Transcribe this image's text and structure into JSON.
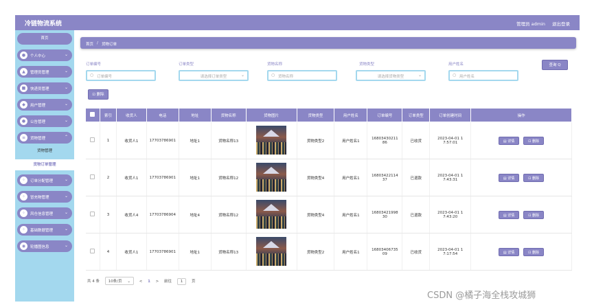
{
  "app": {
    "title": "冷链物流系统",
    "user": "管理员 admin",
    "logout": "退出登录"
  },
  "sidebar": {
    "home": "首页",
    "items": [
      {
        "label": "个人中心",
        "icon": "person-icon"
      },
      {
        "label": "管理员管理",
        "icon": "admin-icon"
      },
      {
        "label": "快递员管理",
        "icon": "courier-icon"
      },
      {
        "label": "用户管理",
        "icon": "users-icon"
      },
      {
        "label": "公告管理",
        "icon": "notice-icon"
      },
      {
        "label": "货物管理",
        "icon": "goods-icon"
      },
      {
        "label": "订单分配管理",
        "icon": "assign-icon"
      },
      {
        "label": "冒充物管理",
        "icon": "grid-icon"
      },
      {
        "label": "风仓信息管理",
        "icon": "warehouse-icon"
      },
      {
        "label": "基础数据管理",
        "icon": "data-icon"
      },
      {
        "label": "轮播图信息",
        "icon": "carousel-icon"
      }
    ],
    "sub_goods": "货物管理",
    "sub_orders": "货物订单管理"
  },
  "breadcrumb": {
    "home": "首页",
    "sep": "/",
    "current": "货物订单"
  },
  "filters": {
    "order_no": {
      "label": "订单编号",
      "placeholder": "订单编号"
    },
    "order_type": {
      "label": "订单类型",
      "placeholder": "请选择订单类型"
    },
    "goods_name": {
      "label": "货物名称",
      "placeholder": "货物名称"
    },
    "goods_type": {
      "label": "货物类型",
      "placeholder": "请选择货物类型"
    },
    "user_name": {
      "label": "用户姓名",
      "placeholder": "用户姓名"
    }
  },
  "buttons": {
    "query": "查询 Q",
    "delete": "删除",
    "detail": "详情",
    "row_delete": "删除"
  },
  "table": {
    "headers": [
      "",
      "索引",
      "收货人",
      "电话",
      "地址",
      "货物名称",
      "货物图片",
      "货物类型",
      "用户姓名",
      "订单编号",
      "订单类型",
      "订单创建时间",
      "操作"
    ],
    "rows": [
      {
        "idx": "1",
        "receiver": "收货人1",
        "phone": "17703786901",
        "addr": "地址1",
        "goods": "货物名称13",
        "gtype": "货物类型2",
        "user": "用户姓名1",
        "order_no_a": "16803430211",
        "order_no_b": "86",
        "otype": "已收货",
        "time_a": "2023-04-01 1",
        "time_b": "7:57:01"
      },
      {
        "idx": "2",
        "receiver": "收货人1",
        "phone": "17703786901",
        "addr": "地址1",
        "goods": "货物名称12",
        "gtype": "货物类型4",
        "user": "用户姓名1",
        "order_no_a": "16803422114",
        "order_no_b": "37",
        "otype": "已退款",
        "time_a": "2023-04-01 1",
        "time_b": "7:43:31"
      },
      {
        "idx": "3",
        "receiver": "收货人4",
        "phone": "17703786904",
        "addr": "地址4",
        "goods": "货物名称12",
        "gtype": "货物类型4",
        "user": "用户姓名1",
        "order_no_a": "16803421998",
        "order_no_b": "30",
        "otype": "已退款",
        "time_a": "2023-04-01 1",
        "time_b": "7:43:20"
      },
      {
        "idx": "4",
        "receiver": "收货人1",
        "phone": "17703786901",
        "addr": "地址1",
        "goods": "货物名称13",
        "gtype": "货物类型2",
        "user": "用户姓名1",
        "order_no_a": "16803406735",
        "order_no_b": "09",
        "otype": "已收货",
        "time_a": "2023-04-01 1",
        "time_b": "7:17:54"
      }
    ]
  },
  "pager": {
    "total": "共 4 条",
    "page_size": "10条/页",
    "prev": "<",
    "current": "1",
    "next": ">",
    "goto": "前往",
    "goto_val": "1",
    "page_unit": "页"
  },
  "watermark": "CSDN @橘子海全栈攻城狮",
  "colors": {
    "accent": "#8a86c6",
    "sidebar": "#a3d8ee"
  }
}
